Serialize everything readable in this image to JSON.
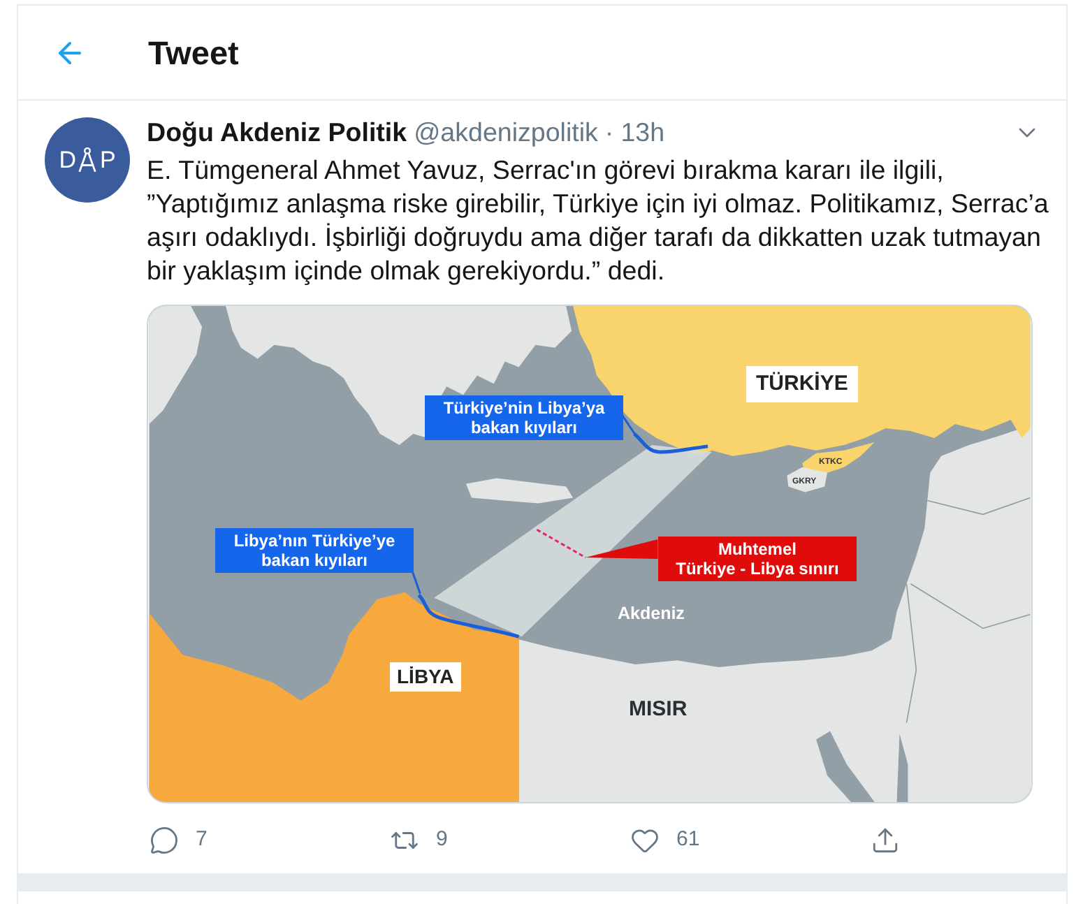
{
  "header": {
    "title": "Tweet"
  },
  "tweet": {
    "avatar": {
      "letters": [
        "D",
        "P"
      ]
    },
    "author": {
      "name": "Doğu Akdeniz Politik",
      "handle": "@akdenizpolitik",
      "separator": "·",
      "time": "13h"
    },
    "text": "E. Tümgeneral Ahmet Yavuz, Serrac'ın görevi bırakma kararı ile ilgili, ”Yaptığımız anlaşma riske girebilir, Türkiye için iyi olmaz. Politikamız, Serrac’a aşırı odaklıydı. İşbirliği doğruydu ama diğer tarafı da dikkatten uzak tutmayan bir yaklaşım içinde olmak gerekiyordu.” dedi.",
    "map": {
      "turkey": "TÜRKİYE",
      "turkey_coast": [
        "Türkiye’nin Libya’ya",
        "bakan kıyıları"
      ],
      "north_cyprus": "KTKC",
      "south_cyprus": "GKRY",
      "libya_coast": [
        "Libya’nın Türkiye’ye",
        "bakan kıyıları"
      ],
      "border": [
        "Muhtemel",
        "Türkiye - Libya sınırı"
      ],
      "sea": "Akdeniz",
      "libya": "LİBYA",
      "egypt": "MISIR"
    },
    "actions": [
      {
        "kind": "reply",
        "count": "7"
      },
      {
        "kind": "retweet",
        "count": "9"
      },
      {
        "kind": "like",
        "count": "61"
      },
      {
        "kind": "share"
      }
    ]
  }
}
